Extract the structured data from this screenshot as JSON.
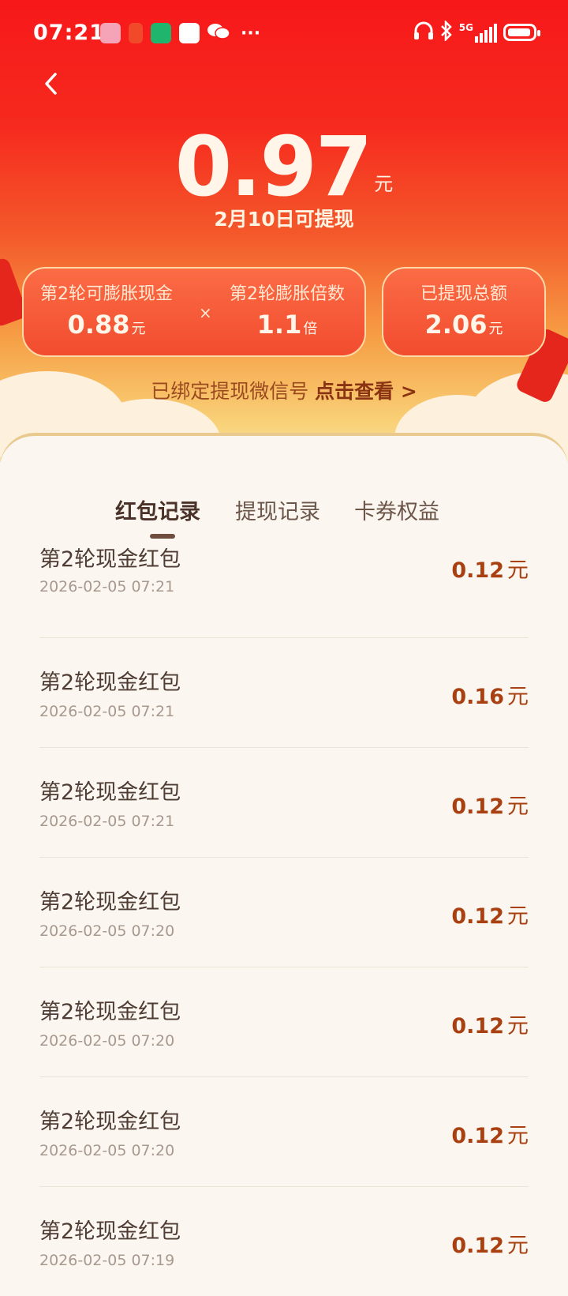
{
  "status_bar": {
    "time": "07:21",
    "network": "5G"
  },
  "header": {
    "amount": "0.97",
    "amount_unit": "元",
    "subtitle": "2月10日可提现"
  },
  "stats": {
    "round_cash_label": "第2轮可膨胀现金",
    "round_cash_value": "0.88",
    "round_cash_unit": "元",
    "multiply_sign": "×",
    "multiplier_label": "第2轮膨胀倍数",
    "multiplier_value": "1.1",
    "multiplier_unit": "倍",
    "withdrawn_label": "已提现总额",
    "withdrawn_value": "2.06",
    "withdrawn_unit": "元"
  },
  "wechat_bind": {
    "text": "已绑定提现微信号",
    "link": "点击查看 >"
  },
  "tabs": [
    {
      "label": "红包记录",
      "active": true
    },
    {
      "label": "提现记录",
      "active": false
    },
    {
      "label": "卡券权益",
      "active": false
    }
  ],
  "records": [
    {
      "title": "第2轮现金红包",
      "date": "2026-02-05 07:21",
      "amount": "0.12",
      "unit": "元"
    },
    {
      "title": "第2轮现金红包",
      "date": "2026-02-05 07:21",
      "amount": "0.16",
      "unit": "元"
    },
    {
      "title": "第2轮现金红包",
      "date": "2026-02-05 07:21",
      "amount": "0.12",
      "unit": "元"
    },
    {
      "title": "第2轮现金红包",
      "date": "2026-02-05 07:20",
      "amount": "0.12",
      "unit": "元"
    },
    {
      "title": "第2轮现金红包",
      "date": "2026-02-05 07:20",
      "amount": "0.12",
      "unit": "元"
    },
    {
      "title": "第2轮现金红包",
      "date": "2026-02-05 07:20",
      "amount": "0.12",
      "unit": "元"
    },
    {
      "title": "第2轮现金红包",
      "date": "2026-02-05 07:19",
      "amount": "0.12",
      "unit": "元"
    }
  ],
  "colors": {
    "header_red": "#f7181a",
    "amount_brown": "#a84012",
    "page_bg": "#fbf7f0"
  }
}
